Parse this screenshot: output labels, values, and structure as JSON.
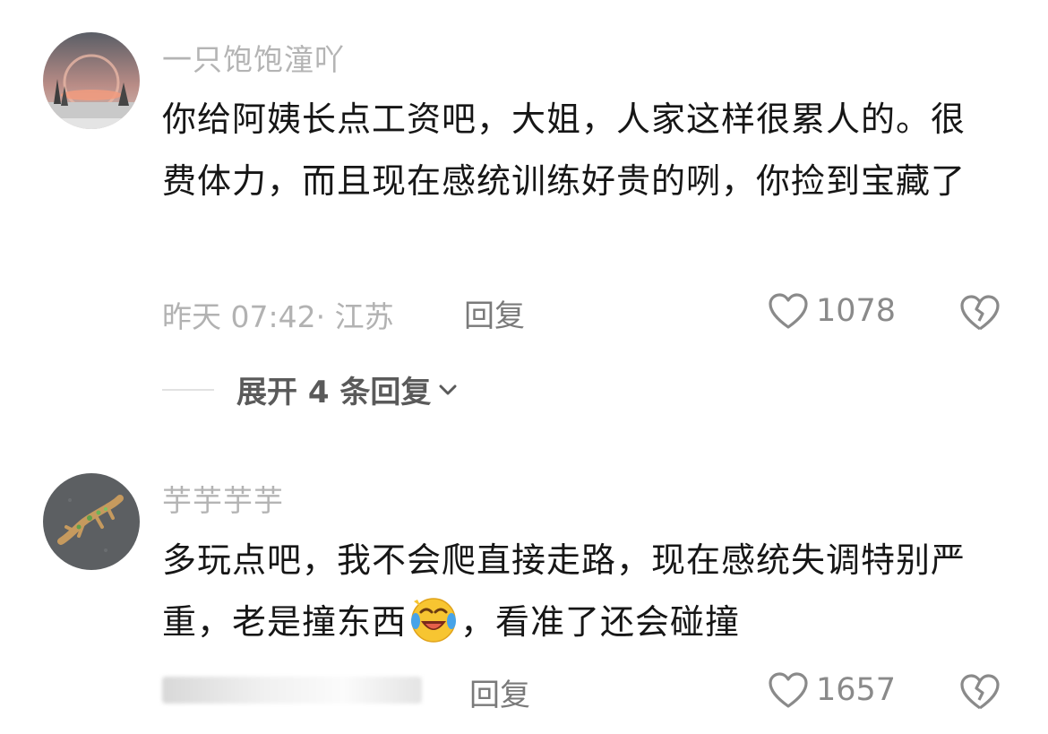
{
  "comments": [
    {
      "username": "一只饱饱潼吖",
      "text": "你给阿姨长点工资吧，大姐，人家这样很累人的。很费体力，而且现在感统训练好贵的咧，你捡到宝藏了",
      "time_location": "昨天 07:42· 江苏",
      "reply_label": "回复",
      "likes": "1078",
      "expand_label": "展开 4 条回复",
      "avatar_icon": "sunset-landscape-avatar"
    },
    {
      "username": "芋芋芋芋",
      "text_before_emoji": "多玩点吧，我不会爬直接走路，现在感统失调特别严重，老是撞东西",
      "emoji": "rolling-laughing-face-icon",
      "text_after_emoji": "，看准了还会碰撞",
      "reply_label": "回复",
      "likes": "1657",
      "avatar_icon": "lizard-figure-avatar"
    }
  ],
  "colors": {
    "username": "#b4b4b4",
    "body_text": "#161616",
    "meta": "#b2b2b2",
    "icon_gray": "#8a8a8a"
  }
}
